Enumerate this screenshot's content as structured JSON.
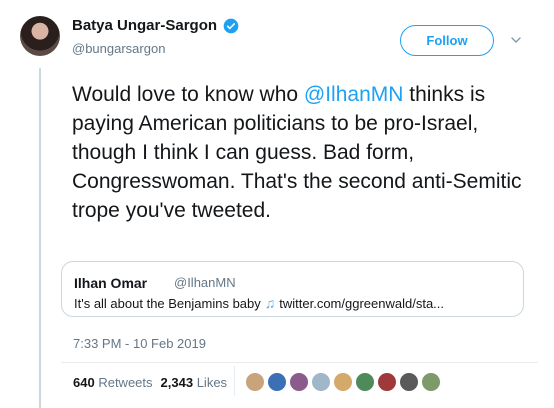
{
  "author": {
    "display_name": "Batya Ungar-Sargon",
    "handle": "@bungarsargon",
    "verified": true
  },
  "follow_button": {
    "label": "Follow"
  },
  "menu": {
    "icon": "chevron-down-icon"
  },
  "tweet": {
    "text_before": "Would love to know who ",
    "mention": "@IlhanMN",
    "text_after": " thinks is paying American politicians to be pro-Israel, though I think I can guess. Bad form, Congresswoman. That's the second anti-Semitic trope you've tweeted."
  },
  "quoted_tweet": {
    "display_name": "Ilhan Omar",
    "handle": "@IlhanMN",
    "text": "It's all about the Benjamins baby",
    "emoji_icon": "music-notes-icon",
    "link": "twitter.com/ggreenwald/sta..."
  },
  "timestamp": "7:33 PM - 10 Feb 2019",
  "stats": {
    "retweets_count": "640",
    "retweets_label": "Retweets",
    "likes_count": "2,343",
    "likes_label": "Likes"
  },
  "likers": [
    {
      "color": "#c9a37c"
    },
    {
      "color": "#3b6fb6"
    },
    {
      "color": "#8a5b8c"
    },
    {
      "color": "#9fb7c9"
    },
    {
      "color": "#d4a96a"
    },
    {
      "color": "#4f8a5b"
    },
    {
      "color": "#a03a3a"
    },
    {
      "color": "#5a5a5a"
    },
    {
      "color": "#7d9a6a"
    }
  ],
  "colors": {
    "accent": "#1da1f2",
    "muted": "#657786",
    "text": "#14171a",
    "border": "#ccd6dd"
  }
}
